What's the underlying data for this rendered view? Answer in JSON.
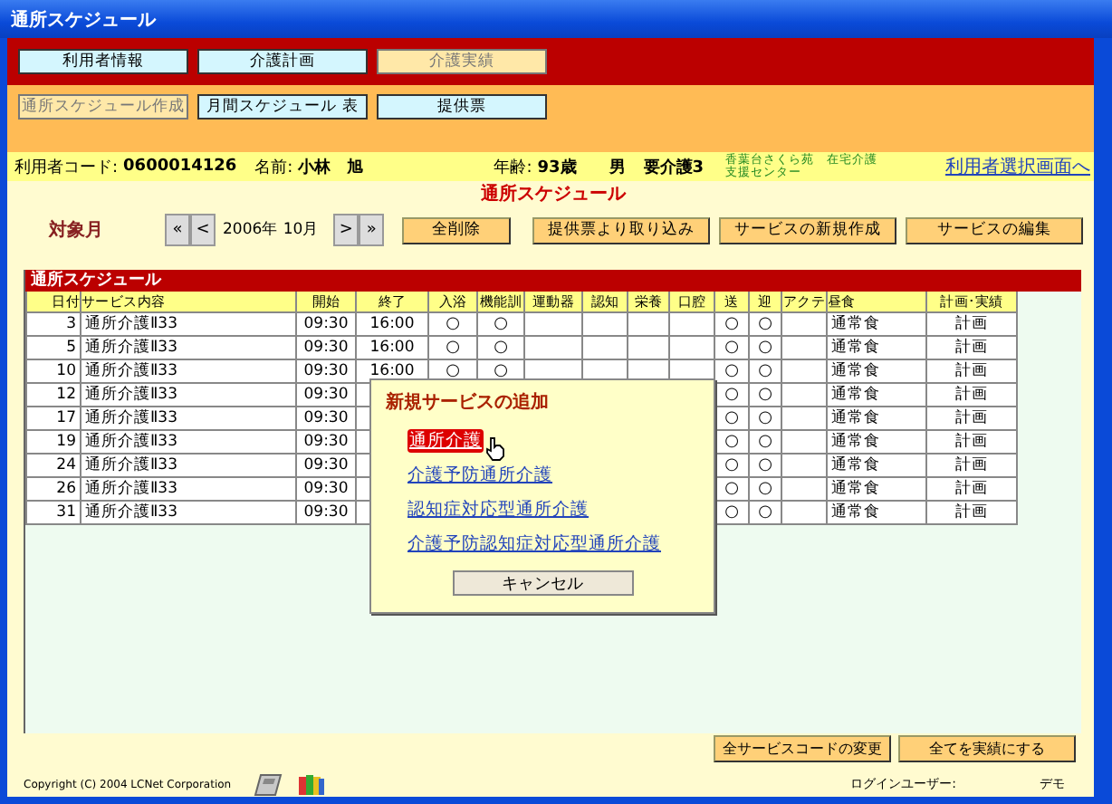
{
  "window": {
    "title": "通所スケジュール"
  },
  "main_tabs": [
    {
      "label": "利用者情報",
      "selected": false
    },
    {
      "label": "介護計画",
      "selected": false
    },
    {
      "label": "介護実績",
      "selected": true
    }
  ],
  "sub_tabs": [
    {
      "label": "通所スケジュール作成",
      "selected": true
    },
    {
      "label": "月間スケジュール 表",
      "selected": false
    },
    {
      "label": "提供票",
      "selected": false
    }
  ],
  "user_info": {
    "code_label": "利用者コード:",
    "code": "0600014126",
    "name_label": "名前:",
    "name": "小林　旭",
    "age_label": "年齢:",
    "age": "93歳",
    "sex": "男",
    "care_level": "要介護3",
    "office": "香葉台さくら苑　在宅介護支援センター",
    "back_link": "利用者選択画面へ"
  },
  "page_title": "通所スケジュール",
  "month_nav": {
    "label": "対象月",
    "prev": [
      "«",
      "<"
    ],
    "month": "2006年 10月",
    "next": [
      ">",
      "»"
    ]
  },
  "delete_all": "全削除",
  "actions": [
    "提供票より取り込み",
    "サービスの新規作成",
    "サービスの編集"
  ],
  "schedule": {
    "title": "通所スケジュール",
    "columns": [
      "日付",
      "サービス内容",
      "開始",
      "終了",
      "入浴",
      "機能訓",
      "運動器",
      "認知",
      "栄養",
      "口腔",
      "送",
      "迎",
      "アクテ",
      "昼食",
      "計画･実績"
    ],
    "rows": [
      {
        "day": "3",
        "service": "通所介護Ⅱ33",
        "start": "09:30",
        "end": "16:00",
        "bath": "○",
        "training": "○",
        "pickup": "○",
        "dropoff": "○",
        "lunch": "通常食",
        "plan": "計画"
      },
      {
        "day": "5",
        "service": "通所介護Ⅱ33",
        "start": "09:30",
        "end": "16:00",
        "bath": "○",
        "training": "○",
        "pickup": "○",
        "dropoff": "○",
        "lunch": "通常食",
        "plan": "計画"
      },
      {
        "day": "10",
        "service": "通所介護Ⅱ33",
        "start": "09:30",
        "end": "16:00",
        "bath": "○",
        "training": "○",
        "pickup": "○",
        "dropoff": "○",
        "lunch": "通常食",
        "plan": "計画"
      },
      {
        "day": "12",
        "service": "通所介護Ⅱ33",
        "start": "09:30",
        "pickup": "○",
        "dropoff": "○",
        "lunch": "通常食",
        "plan": "計画"
      },
      {
        "day": "17",
        "service": "通所介護Ⅱ33",
        "start": "09:30",
        "pickup": "○",
        "dropoff": "○",
        "lunch": "通常食",
        "plan": "計画"
      },
      {
        "day": "19",
        "service": "通所介護Ⅱ33",
        "start": "09:30",
        "pickup": "○",
        "dropoff": "○",
        "lunch": "通常食",
        "plan": "計画"
      },
      {
        "day": "24",
        "service": "通所介護Ⅱ33",
        "start": "09:30",
        "pickup": "○",
        "dropoff": "○",
        "lunch": "通常食",
        "plan": "計画"
      },
      {
        "day": "26",
        "service": "通所介護Ⅱ33",
        "start": "09:30",
        "pickup": "○",
        "dropoff": "○",
        "lunch": "通常食",
        "plan": "計画"
      },
      {
        "day": "31",
        "service": "通所介護Ⅱ33",
        "start": "09:30",
        "pickup": "○",
        "dropoff": "○",
        "lunch": "通常食",
        "plan": "計画"
      }
    ]
  },
  "popup": {
    "title": "新規サービスの追加",
    "items": [
      {
        "label": "通所介護",
        "selected": true
      },
      {
        "label": "介護予防通所介護",
        "selected": false
      },
      {
        "label": "認知症対応型通所介護",
        "selected": false
      },
      {
        "label": "介護予防認知症対応型通所介護",
        "selected": false
      }
    ],
    "cancel": "キャンセル"
  },
  "bottom_buttons": [
    "全サービスコードの変更",
    "全てを実績にする"
  ],
  "footer": {
    "copyright": "Copyright (C) 2004 LCNet Corporation",
    "login_label": "ログインユーザー:",
    "login_user": "デモ"
  }
}
